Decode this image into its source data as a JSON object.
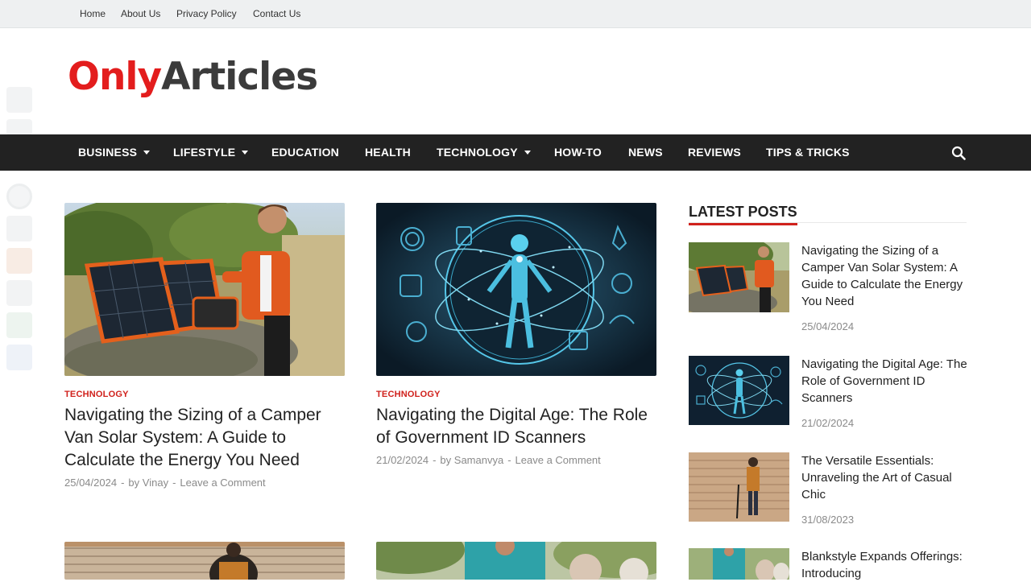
{
  "topnav": [
    "Home",
    "About Us",
    "Privacy Policy",
    "Contact Us"
  ],
  "logo": {
    "part1": "Only",
    "part2": "Articles"
  },
  "mainnav": [
    {
      "label": "BUSINESS",
      "dropdown": true
    },
    {
      "label": "LIFESTYLE",
      "dropdown": true
    },
    {
      "label": "EDUCATION",
      "dropdown": false
    },
    {
      "label": "HEALTH",
      "dropdown": false
    },
    {
      "label": "TECHNOLOGY",
      "dropdown": true
    },
    {
      "label": "HOW-TO",
      "dropdown": false
    },
    {
      "label": "NEWS",
      "dropdown": false
    },
    {
      "label": "REVIEWS",
      "dropdown": false
    },
    {
      "label": "TIPS & TRICKS",
      "dropdown": false
    }
  ],
  "icons": {
    "search": "search-icon",
    "social": [
      "facebook-icon",
      "twitter-icon",
      "email-icon",
      "pinterest-icon",
      "tumblr-icon",
      "reddit-icon",
      "linkedin-icon",
      "whatsapp-icon",
      "share-icon"
    ]
  },
  "colors": {
    "brand_red": "#e31d1d",
    "nav_bg": "#222222",
    "topbar_bg": "#eef0f1",
    "category": "#d0211c"
  },
  "posts": [
    {
      "category": "TECHNOLOGY",
      "title": "Navigating the Sizing of a Camper Van Solar System: A Guide to Calculate the Energy You Need",
      "date": "25/04/2024",
      "by": "by",
      "author": "Vinay",
      "comment": "Leave a Comment"
    },
    {
      "category": "TECHNOLOGY",
      "title": "Navigating the Digital Age: The Role of Government ID Scanners",
      "date": "21/02/2024",
      "by": "by",
      "author": "Samanvya",
      "comment": "Leave a Comment"
    }
  ],
  "sidebar": {
    "title": "LATEST POSTS",
    "items": [
      {
        "title": "Navigating the Sizing of a Camper Van Solar System: A Guide to Calculate the Energy You Need",
        "date": "25/04/2024"
      },
      {
        "title": "Navigating the Digital Age: The Role of Government ID Scanners",
        "date": "21/02/2024"
      },
      {
        "title": "The Versatile Essentials: Unraveling the Art of Casual Chic",
        "date": "31/08/2023"
      },
      {
        "title": "Blankstyle Expands Offerings: Introducing",
        "date": ""
      }
    ]
  }
}
